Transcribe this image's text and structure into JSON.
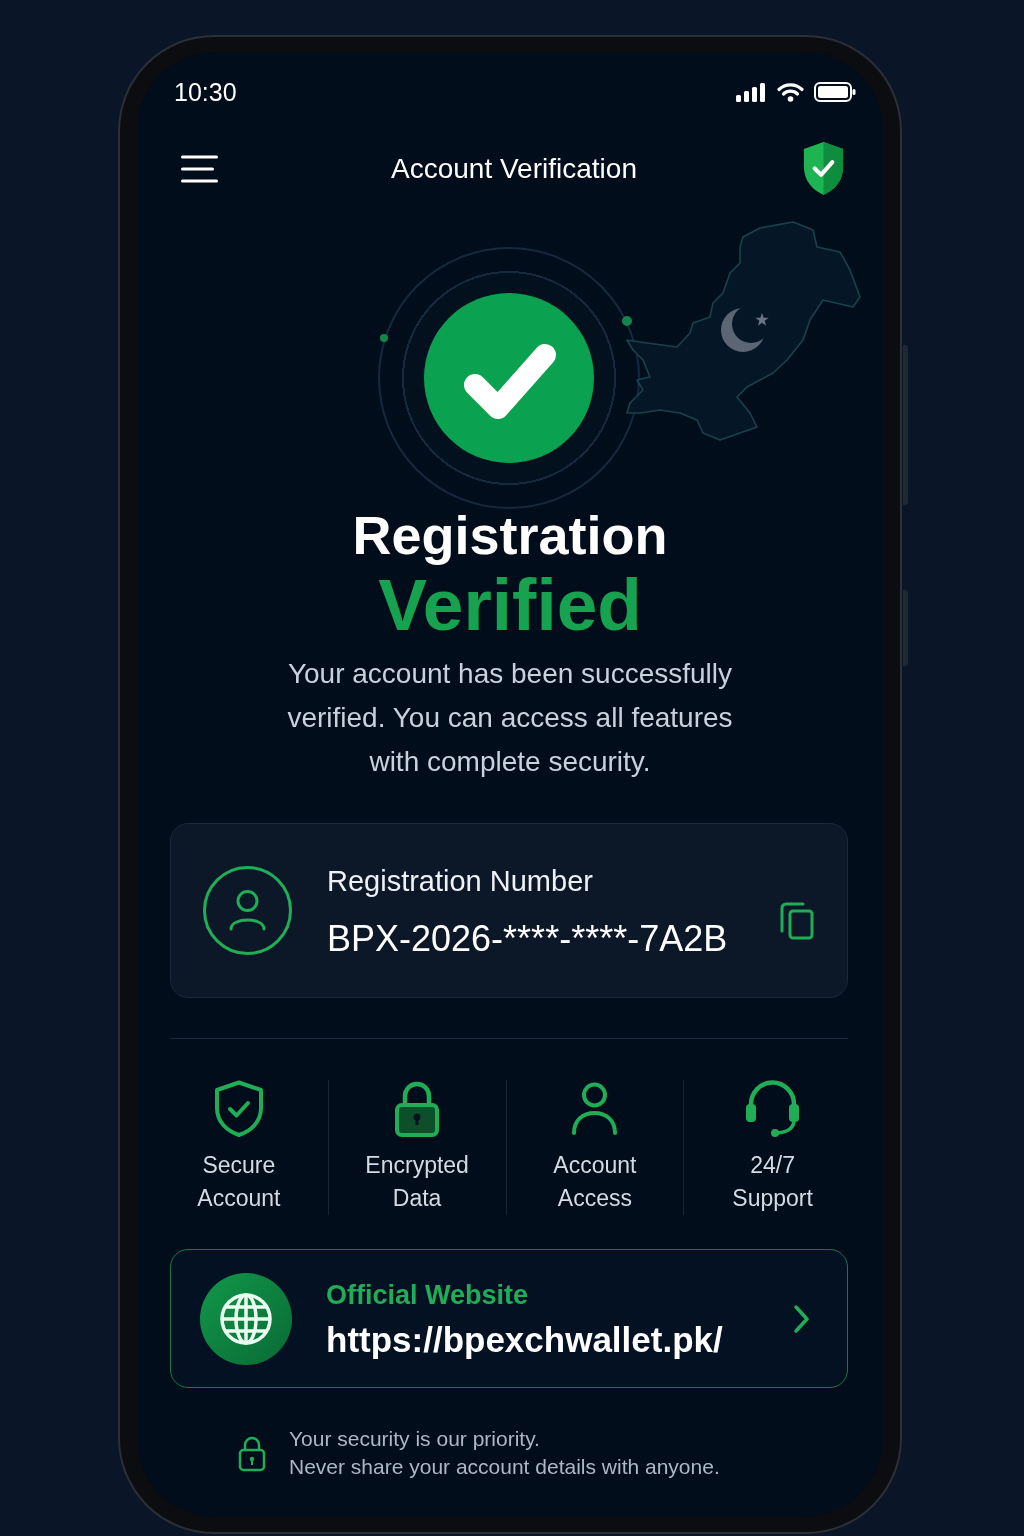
{
  "status_bar": {
    "time": "10:30"
  },
  "header": {
    "title": "Account Verification"
  },
  "hero": {
    "title": "Registration",
    "highlight": "Verified",
    "message": "Your account has been successfully verified. You can access all features with complete security."
  },
  "registration": {
    "label": "Registration Number",
    "value": "BPX-2026-****-****-7A2B"
  },
  "features": [
    {
      "label": "Secure Account"
    },
    {
      "label": "Encrypted Data"
    },
    {
      "label": "Account Access"
    },
    {
      "label": "24/7 Support"
    }
  ],
  "website": {
    "label": "Official Website",
    "url": "https://bpexchwallet.pk/"
  },
  "security_note": {
    "lines": [
      "Your security is our priority.",
      "Never share your account details with anyone."
    ]
  }
}
